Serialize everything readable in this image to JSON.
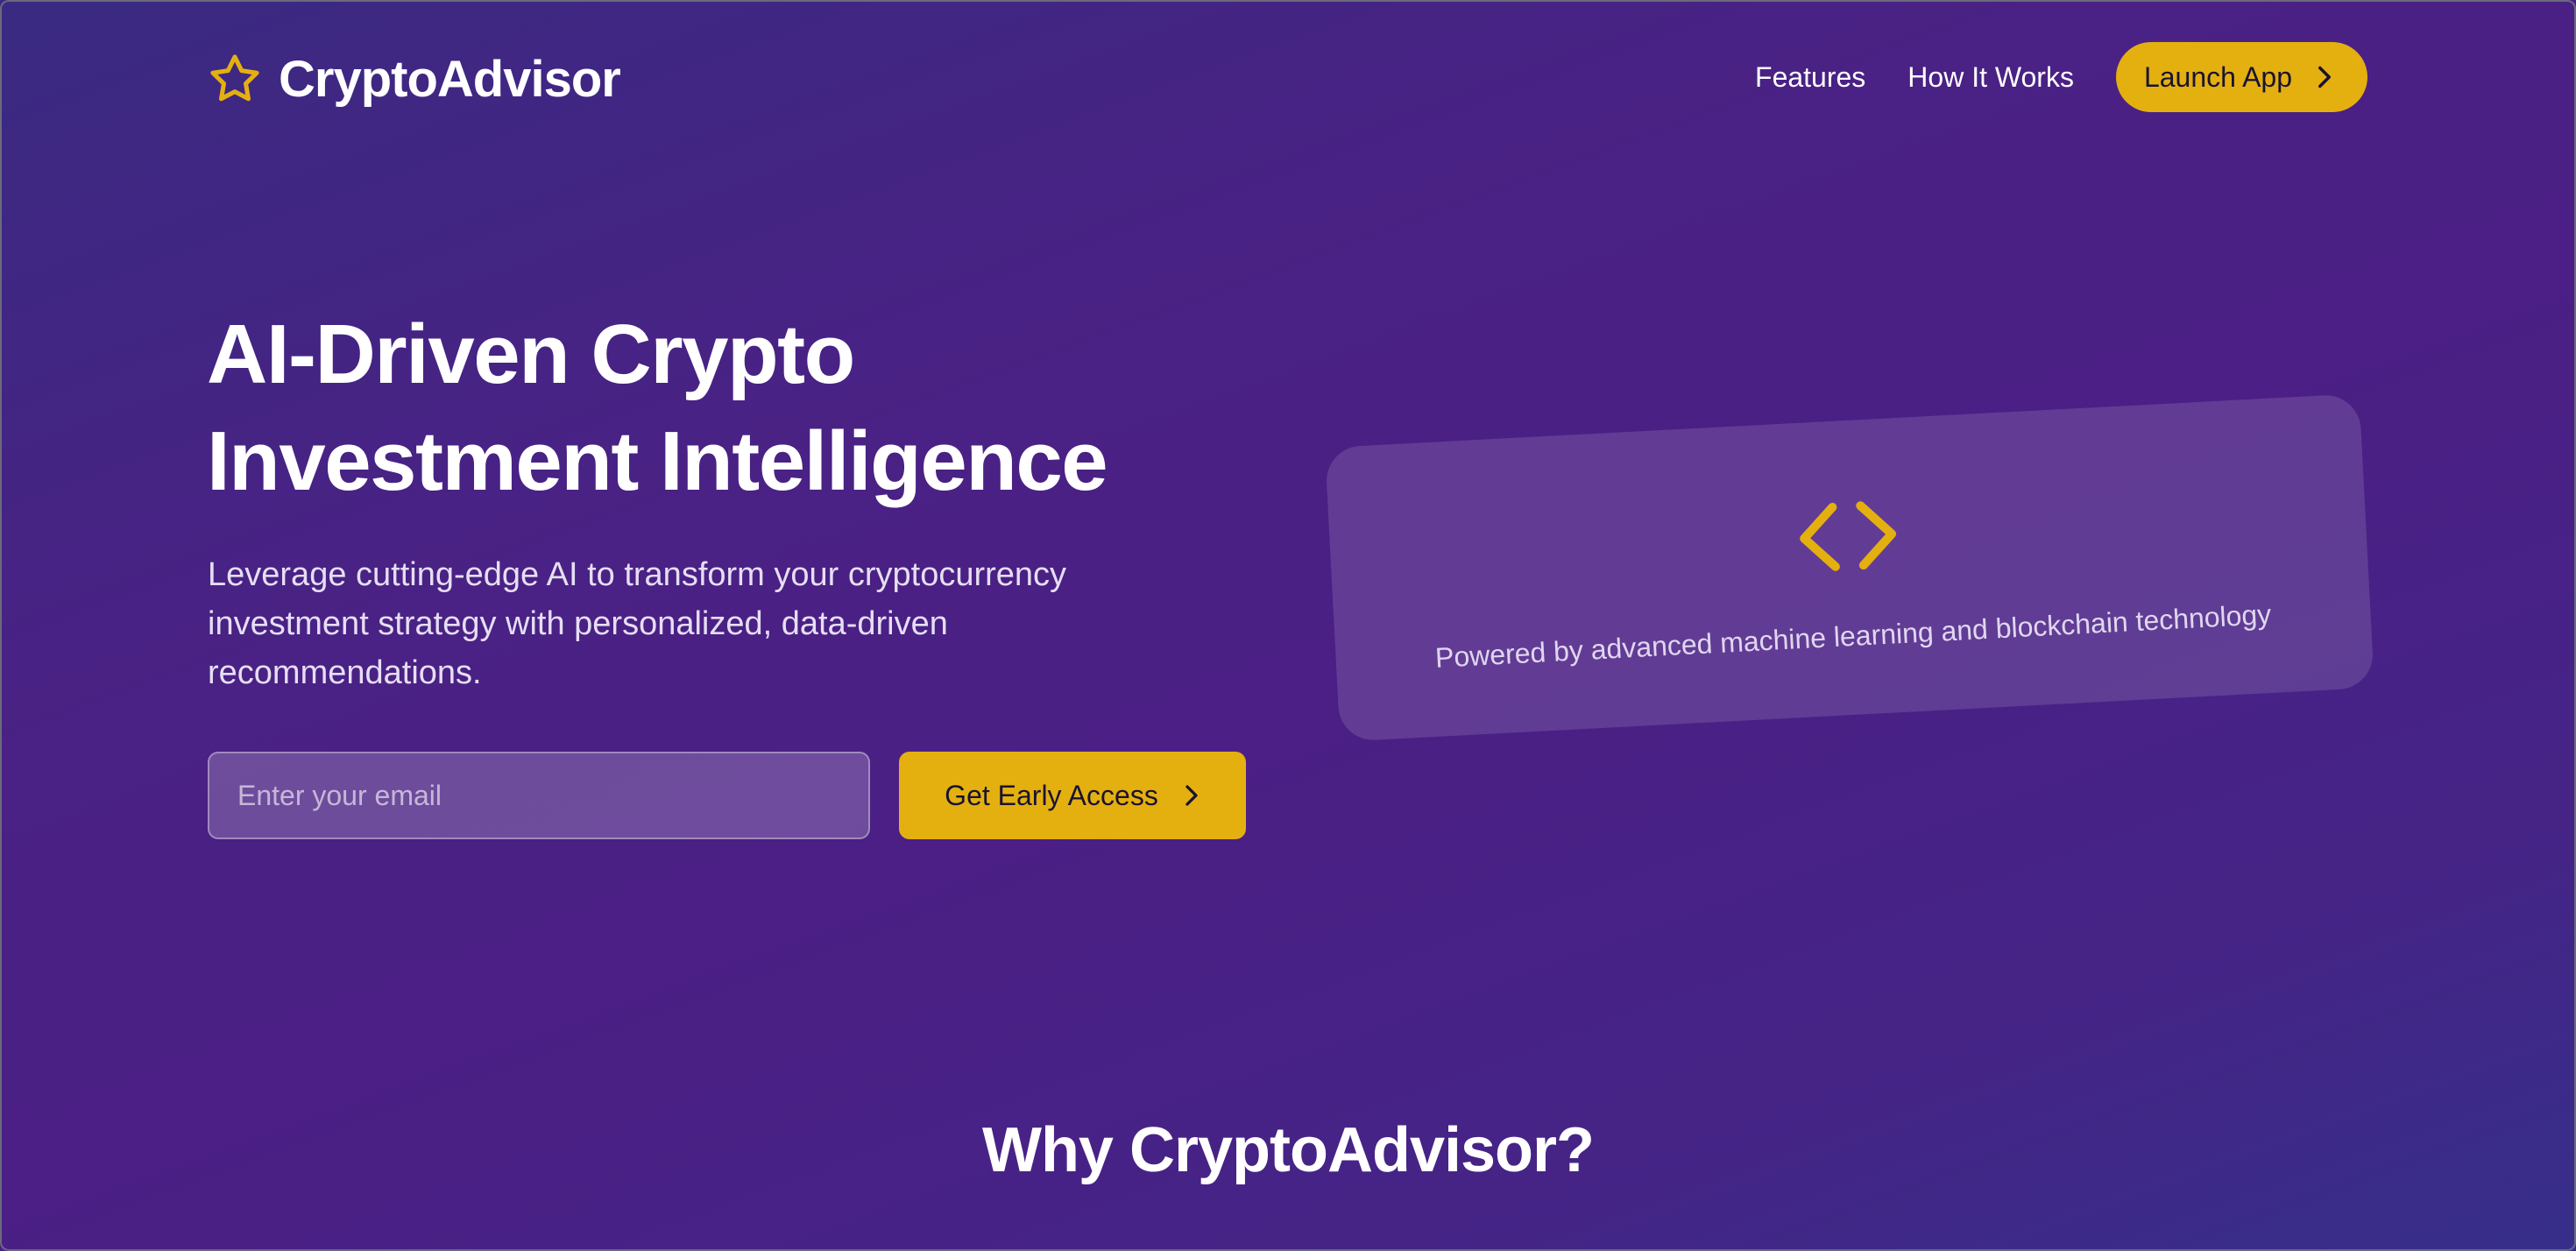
{
  "brand": {
    "name": "CryptoAdvisor",
    "icon": "star-icon",
    "accent_color": "#e4b010"
  },
  "nav": {
    "links": [
      {
        "label": "Features"
      },
      {
        "label": "How It Works"
      }
    ],
    "launch_label": "Launch App"
  },
  "hero": {
    "title_line1": "AI-Driven Crypto",
    "title_line2": "Investment Intelligence",
    "subtitle": "Leverage cutting-edge AI to transform your cryptocurrency investment strategy with personalized, data-driven recommendations.",
    "email_placeholder": "Enter your email",
    "email_value": "",
    "cta_label": "Get Early Access"
  },
  "tech_card": {
    "icon": "code-icon",
    "caption": "Powered by advanced machine learning and blockchain technology"
  },
  "section": {
    "title": "Why CryptoAdvisor?"
  }
}
